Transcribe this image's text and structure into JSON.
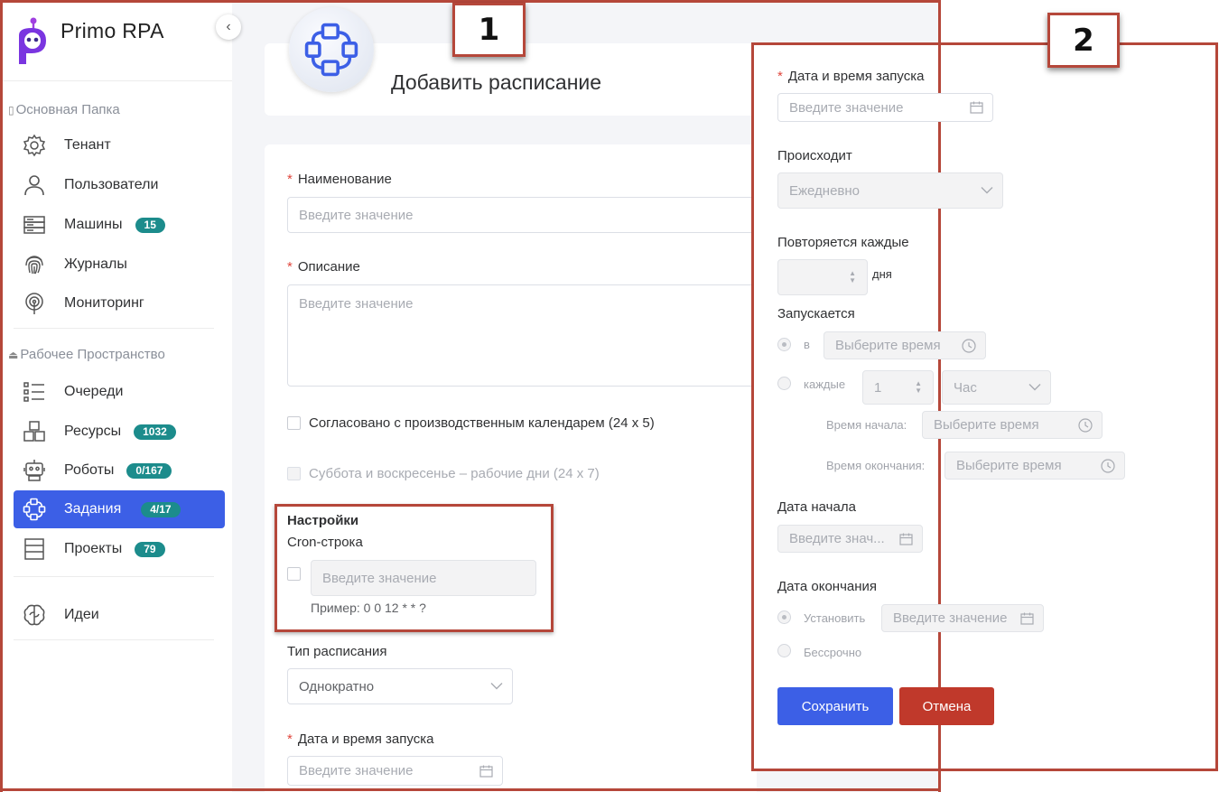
{
  "app": {
    "title": "Primo RPA"
  },
  "sidebar": {
    "section1": "Основная Папка",
    "section2": "Рабочее Пространство",
    "items": [
      {
        "label": "Тенант",
        "icon": "gear-icon"
      },
      {
        "label": "Пользователи",
        "icon": "user-icon"
      },
      {
        "label": "Машины",
        "icon": "server-icon",
        "badge": "15"
      },
      {
        "label": "Журналы",
        "icon": "fingerprint-icon"
      },
      {
        "label": "Мониторинг",
        "icon": "monitoring-icon"
      },
      {
        "label": "Очереди",
        "icon": "list-icon"
      },
      {
        "label": "Ресурсы",
        "icon": "boxes-icon",
        "badge": "1032"
      },
      {
        "label": "Роботы",
        "icon": "robot-icon",
        "badge": "0/167"
      },
      {
        "label": "Задания",
        "icon": "schedule-icon",
        "badge": "4/17",
        "active": true
      },
      {
        "label": "Проекты",
        "icon": "stack-icon",
        "badge": "79"
      },
      {
        "label": "Идеи",
        "icon": "brain-icon"
      }
    ]
  },
  "main": {
    "title": "Добавить расписание",
    "name_label": "Наименование",
    "name_placeholder": "Введите значение",
    "desc_label": "Описание",
    "desc_placeholder": "Введите значение",
    "cb_calendar": "Согласовано с производственным календарем (24 x 5)",
    "cb_weekend": "Суббота и воскресенье – рабочие дни (24 x 7)",
    "settings_title": "Настройки",
    "cron_label": "Cron-строка",
    "cron_placeholder": "Введите значение",
    "cron_example": "Пример: 0 0 12 * * ?",
    "type_label": "Тип расписания",
    "type_value": "Однократно",
    "launch_label": "Дата и время запуска",
    "launch_placeholder": "Введите значение"
  },
  "panel2": {
    "launch_label": "Дата и время запуска",
    "launch_placeholder": "Введите значение",
    "occurs_label": "Происходит",
    "occurs_value": "Ежедневно",
    "repeat_label": "Повторяется каждые",
    "repeat_unit": "дня",
    "starts_label": "Запускается",
    "at_label": "в",
    "at_placeholder": "Выберите время",
    "every_label": "каждые",
    "every_value": "1",
    "every_unit": "Час",
    "start_time_label": "Время начала:",
    "start_time_placeholder": "Выберите время",
    "end_time_label": "Время окончания:",
    "end_time_placeholder": "Выберите время",
    "start_date_label": "Дата начала",
    "start_date_placeholder": "Введите знач...",
    "end_date_label": "Дата окончания",
    "set_label": "Установить",
    "set_placeholder": "Введите значение",
    "forever_label": "Бессрочно",
    "save_label": "Сохранить",
    "cancel_label": "Отмена"
  },
  "annotations": {
    "tag1": "1",
    "tag2": "2"
  },
  "colors": {
    "accent": "#3c5fe6",
    "badge": "#1c8c8c",
    "danger": "#c0392b",
    "frame": "#b5473a"
  }
}
